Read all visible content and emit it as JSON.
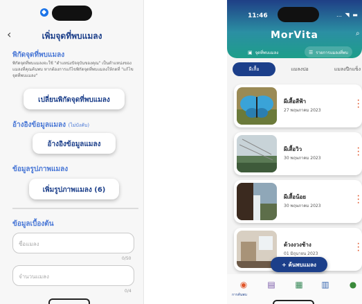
{
  "left_screen": {
    "title": "เพิ่มจุดที่พบแมลง",
    "back_icon": "chevron-left-icon",
    "sections": {
      "location_heading": "พิกัดจุดที่พบแมลง",
      "location_desc": "พิกัดจุดที่พบแมลงจะใช้ \"ตำแหน่งปัจจุบันของคุณ\" เป็นตำแหน่งของแมลงที่คุณค้นพบ หากต้องการแก้ไขพิกัดจุดที่พบแมลงให้กดที่ \"แก้ไขจุดที่พบแมลง\"",
      "change_location_button": "เปลี่ยนพิกัดจุดที่พบแมลง",
      "reference_heading": "อ้างอิงข้อมูลแมลง",
      "reference_note": "(ไม่บังคับ)",
      "reference_button": "อ้างอิงข้อมูลแมลง",
      "photo_heading": "ข้อมูลรูปภาพแมลง",
      "add_photo_button": "เพิ่มรูปภาพแมลง (6)",
      "basic_heading": "ข้อมูลเบื้องต้น",
      "name_placeholder": "ชื่อแมลง",
      "name_counter": "0/50",
      "count_placeholder": "จำนวนแมลง",
      "count_counter": "0/4"
    }
  },
  "right_screen": {
    "status_time": "11:46",
    "app_name": "MorVita",
    "map_pill_label": "จุดที่พบแมลง",
    "list_pill_label": "รายการแมลงที่พบ",
    "tabs": [
      "ผีเสื้อ",
      "แมลงปอ",
      "แมลงปีกแข็ง"
    ],
    "cards": [
      {
        "title": "ผีเสื้อสีฟ้า",
        "date": "27 พฤษภาคม 2023"
      },
      {
        "title": "ผีเสื้อวิว",
        "date": "30 พฤษภาคม 2023"
      },
      {
        "title": "ผีเสื้อน้อย",
        "date": "30 พฤษภาคม 2023"
      },
      {
        "title": "ด้วงงวงช้าง",
        "date": "01 มิถุนายน 2023"
      }
    ],
    "fab_label": "+ ค้นพบแมลง",
    "nav_label": "การค้นพบ",
    "colors": {
      "primary": "#1c3f8a",
      "accent": "#4a78d6",
      "kebab": "#e0562b"
    }
  }
}
